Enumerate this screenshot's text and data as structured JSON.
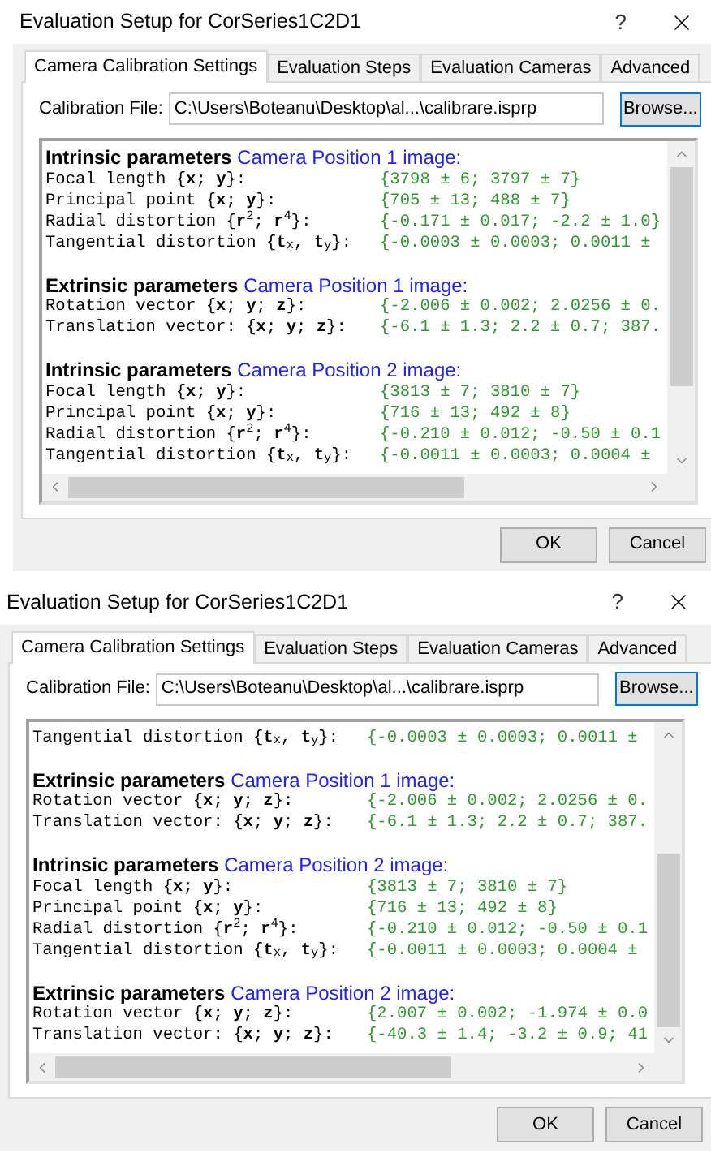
{
  "dialogs": [
    {
      "title": "Evaluation Setup for CorSeries1C2D1",
      "help": "?",
      "tabs": [
        {
          "label": "Camera Calibration Settings",
          "selected": true
        },
        {
          "label": "Evaluation Steps",
          "selected": false
        },
        {
          "label": "Evaluation Cameras",
          "selected": false
        },
        {
          "label": "Advanced",
          "selected": false
        }
      ],
      "calibration_file": {
        "label": "Calibration File:",
        "value": "C:\\Users\\Boteanu\\Desktop\\al...\\calibrare.isprp"
      },
      "browse_button": "Browse...",
      "report": [
        {
          "kind": "heading",
          "label": "Intrinsic parameters",
          "title": "Camera Position 1 image:"
        },
        {
          "kind": "row",
          "label": "Focal length {**x**; **y**}:",
          "value": "{3798 ± 6; 3797 ± 7}"
        },
        {
          "kind": "row",
          "label": "Principal point {**x**; **y**}:",
          "value": "{705 ± 13; 488 ± 7}"
        },
        {
          "kind": "row",
          "label": "Radial distortion {**r**$^{2}$; **r**$^{4}$}:",
          "value": "{-0.171 ± 0.017; -2.2 ± 1.0}"
        },
        {
          "kind": "row",
          "label": "Tangential distortion {**t**$_{x}$, **t**$_{y}$}:",
          "value": "{-0.0003 ± 0.0003; 0.0011 ±"
        },
        {
          "kind": "blank"
        },
        {
          "kind": "heading",
          "label": "Extrinsic parameters",
          "title": "Camera Position 1 image:"
        },
        {
          "kind": "row",
          "label": "Rotation vector {**x**; **y**; **z**}:",
          "value": "{-2.006 ± 0.002; 2.0256 ± 0."
        },
        {
          "kind": "row",
          "label": "Translation vector: {**x**; **y**; **z**}:",
          "value": "{-6.1 ± 1.3; 2.2 ± 0.7; 387."
        },
        {
          "kind": "blank"
        },
        {
          "kind": "heading",
          "label": "Intrinsic parameters",
          "title": "Camera Position 2 image:"
        },
        {
          "kind": "row",
          "label": "Focal length {**x**; **y**}:",
          "value": "{3813 ± 7; 3810 ± 7}"
        },
        {
          "kind": "row",
          "label": "Principal point {**x**; **y**}:",
          "value": "{716 ± 13; 492 ± 8}"
        },
        {
          "kind": "row",
          "label": "Radial distortion {**r**$^{2}$; **r**$^{4}$}:",
          "value": "{-0.210 ± 0.012; -0.50 ± 0.1"
        },
        {
          "kind": "row",
          "label": "Tangential distortion {**t**$_{x}$, **t**$_{y}$}:",
          "value": "{-0.0011 ± 0.0003; 0.0004 ±"
        }
      ],
      "buttons": [
        "OK",
        "Cancel"
      ]
    },
    {
      "title": "Evaluation Setup for CorSeries1C2D1",
      "help": "?",
      "tabs": [
        {
          "label": "Camera Calibration Settings",
          "selected": true
        },
        {
          "label": "Evaluation Steps",
          "selected": false
        },
        {
          "label": "Evaluation Cameras",
          "selected": false
        },
        {
          "label": "Advanced",
          "selected": false
        }
      ],
      "calibration_file": {
        "label": "Calibration File:",
        "value": "C:\\Users\\Boteanu\\Desktop\\al...\\calibrare.isprp"
      },
      "browse_button": "Browse...",
      "report": [
        {
          "kind": "row",
          "label": "Tangential distortion {**t**$_{x}$, **t**$_{y}$}:",
          "value": "{-0.0003 ± 0.0003; 0.0011 ±"
        },
        {
          "kind": "blank"
        },
        {
          "kind": "heading",
          "label": "Extrinsic parameters",
          "title": "Camera Position 1 image:"
        },
        {
          "kind": "row",
          "label": "Rotation vector {**x**; **y**; **z**}:",
          "value": "{-2.006 ± 0.002; 2.0256 ± 0."
        },
        {
          "kind": "row",
          "label": "Translation vector: {**x**; **y**; **z**}:",
          "value": "{-6.1 ± 1.3; 2.2 ± 0.7; 387."
        },
        {
          "kind": "blank"
        },
        {
          "kind": "heading",
          "label": "Intrinsic parameters",
          "title": "Camera Position 2 image:"
        },
        {
          "kind": "row",
          "label": "Focal length {**x**; **y**}:",
          "value": "{3813 ± 7; 3810 ± 7}"
        },
        {
          "kind": "row",
          "label": "Principal point {**x**; **y**}:",
          "value": "{716 ± 13; 492 ± 8}"
        },
        {
          "kind": "row",
          "label": "Radial distortion {**r**$^{2}$; **r**$^{4}$}:",
          "value": "{-0.210 ± 0.012; -0.50 ± 0.1"
        },
        {
          "kind": "row",
          "label": "Tangential distortion {**t**$_{x}$, **t**$_{y}$}:",
          "value": "{-0.0011 ± 0.0003; 0.0004 ±"
        },
        {
          "kind": "blank"
        },
        {
          "kind": "heading",
          "label": "Extrinsic parameters",
          "title": "Camera Position 2 image:"
        },
        {
          "kind": "row",
          "label": "Rotation vector {**x**; **y**; **z**}:",
          "value": "{2.007 ± 0.002; -1.974 ± 0.0"
        },
        {
          "kind": "row",
          "label": "Translation vector: {**x**; **y**; **z**}:",
          "value": "{-40.3 ± 1.4; -3.2 ± 0.9; 41"
        }
      ],
      "buttons": [
        "OK",
        "Cancel"
      ]
    }
  ]
}
